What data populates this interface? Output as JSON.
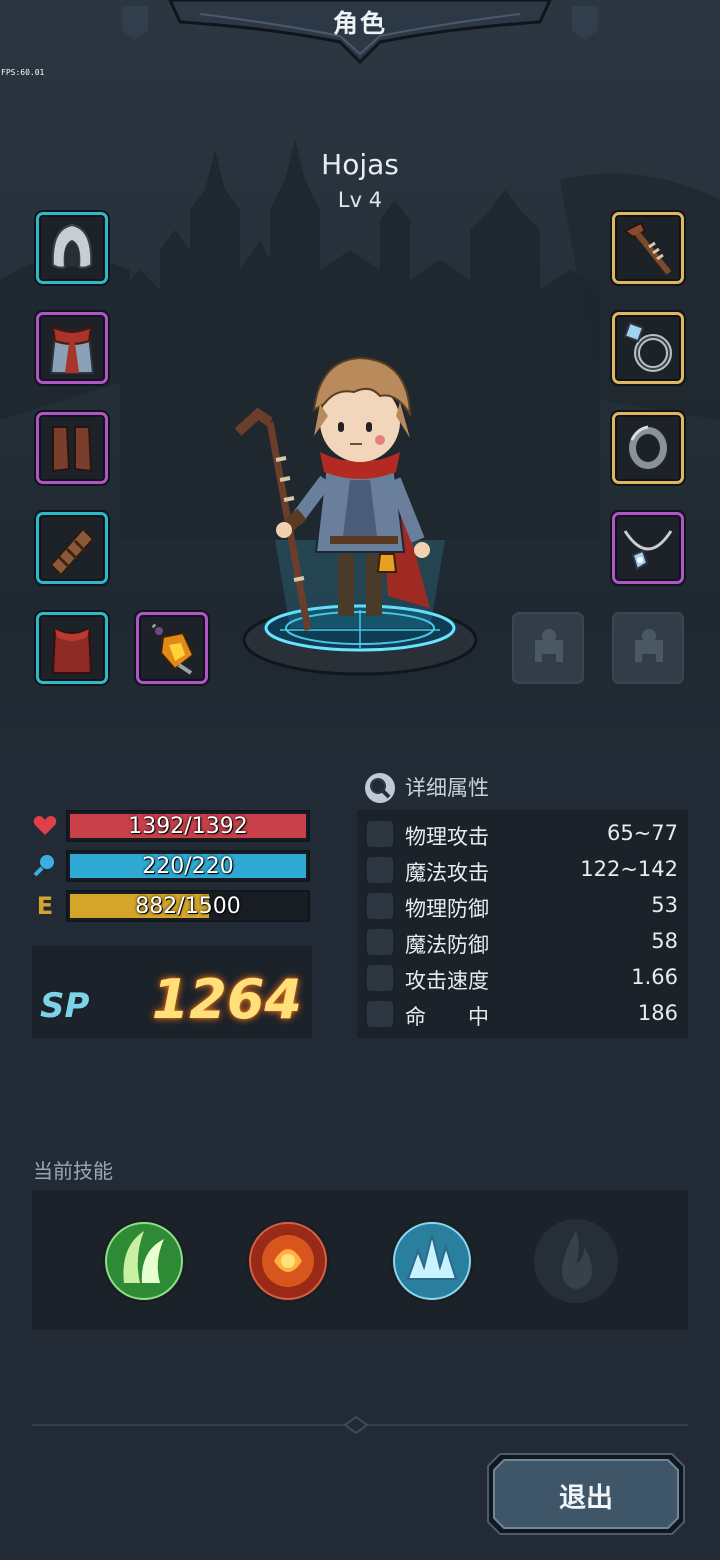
{
  "header": {
    "title": "角色",
    "fps": "FPS:60.01"
  },
  "character": {
    "name": "Hojas",
    "level": "Lv 4"
  },
  "equipment": {
    "left": [
      {
        "name": "hood",
        "rarity": "rare"
      },
      {
        "name": "scarf-tunic",
        "rarity": "epic"
      },
      {
        "name": "boots",
        "rarity": "epic"
      },
      {
        "name": "arm-wrap",
        "rarity": "rare"
      },
      {
        "name": "cloak",
        "rarity": "rare"
      },
      {
        "name": "amber-amulet",
        "rarity": "epic"
      }
    ],
    "right": [
      {
        "name": "wooden-staff",
        "rarity": "legendary"
      },
      {
        "name": "gem-ring",
        "rarity": "legendary"
      },
      {
        "name": "iron-ring",
        "rarity": "legendary"
      },
      {
        "name": "necklace",
        "rarity": "epic"
      },
      {
        "name": "empty-slot",
        "rarity": "locked"
      },
      {
        "name": "empty-slot",
        "rarity": "locked"
      }
    ]
  },
  "bars": {
    "hp": {
      "text": "1392/1392",
      "current": 1392,
      "max": 1392,
      "color": "#c9404a"
    },
    "mp": {
      "text": "220/220",
      "current": 220,
      "max": 220,
      "color": "#2eaad4"
    },
    "exp": {
      "label": "E",
      "text": "882/1500",
      "current": 882,
      "max": 1500,
      "color": "#d4a52a"
    }
  },
  "sp": {
    "label": "SP",
    "value": "1264"
  },
  "attributes": {
    "title": "详细属性",
    "rows": [
      {
        "name": "物理攻击",
        "value": "65~77",
        "icon": "sword-icon"
      },
      {
        "name": "魔法攻击",
        "value": "122~142",
        "icon": "wand-icon"
      },
      {
        "name": "物理防御",
        "value": "53",
        "icon": "shield-icon"
      },
      {
        "name": "魔法防御",
        "value": "58",
        "icon": "magic-shield-icon"
      },
      {
        "name": "攻击速度",
        "value": "1.66",
        "icon": "speed-icon"
      },
      {
        "name": "命　　中",
        "value": "186",
        "icon": "target-icon"
      }
    ]
  },
  "skills": {
    "title": "当前技能",
    "items": [
      {
        "name": "wind-skill",
        "color": "#3aa040"
      },
      {
        "name": "fire-skill",
        "color": "#c24a22"
      },
      {
        "name": "ice-skill",
        "color": "#3a9ab8"
      },
      {
        "name": "locked-skill",
        "color": "#2c353e"
      }
    ]
  },
  "footer": {
    "exit_label": "退出"
  }
}
